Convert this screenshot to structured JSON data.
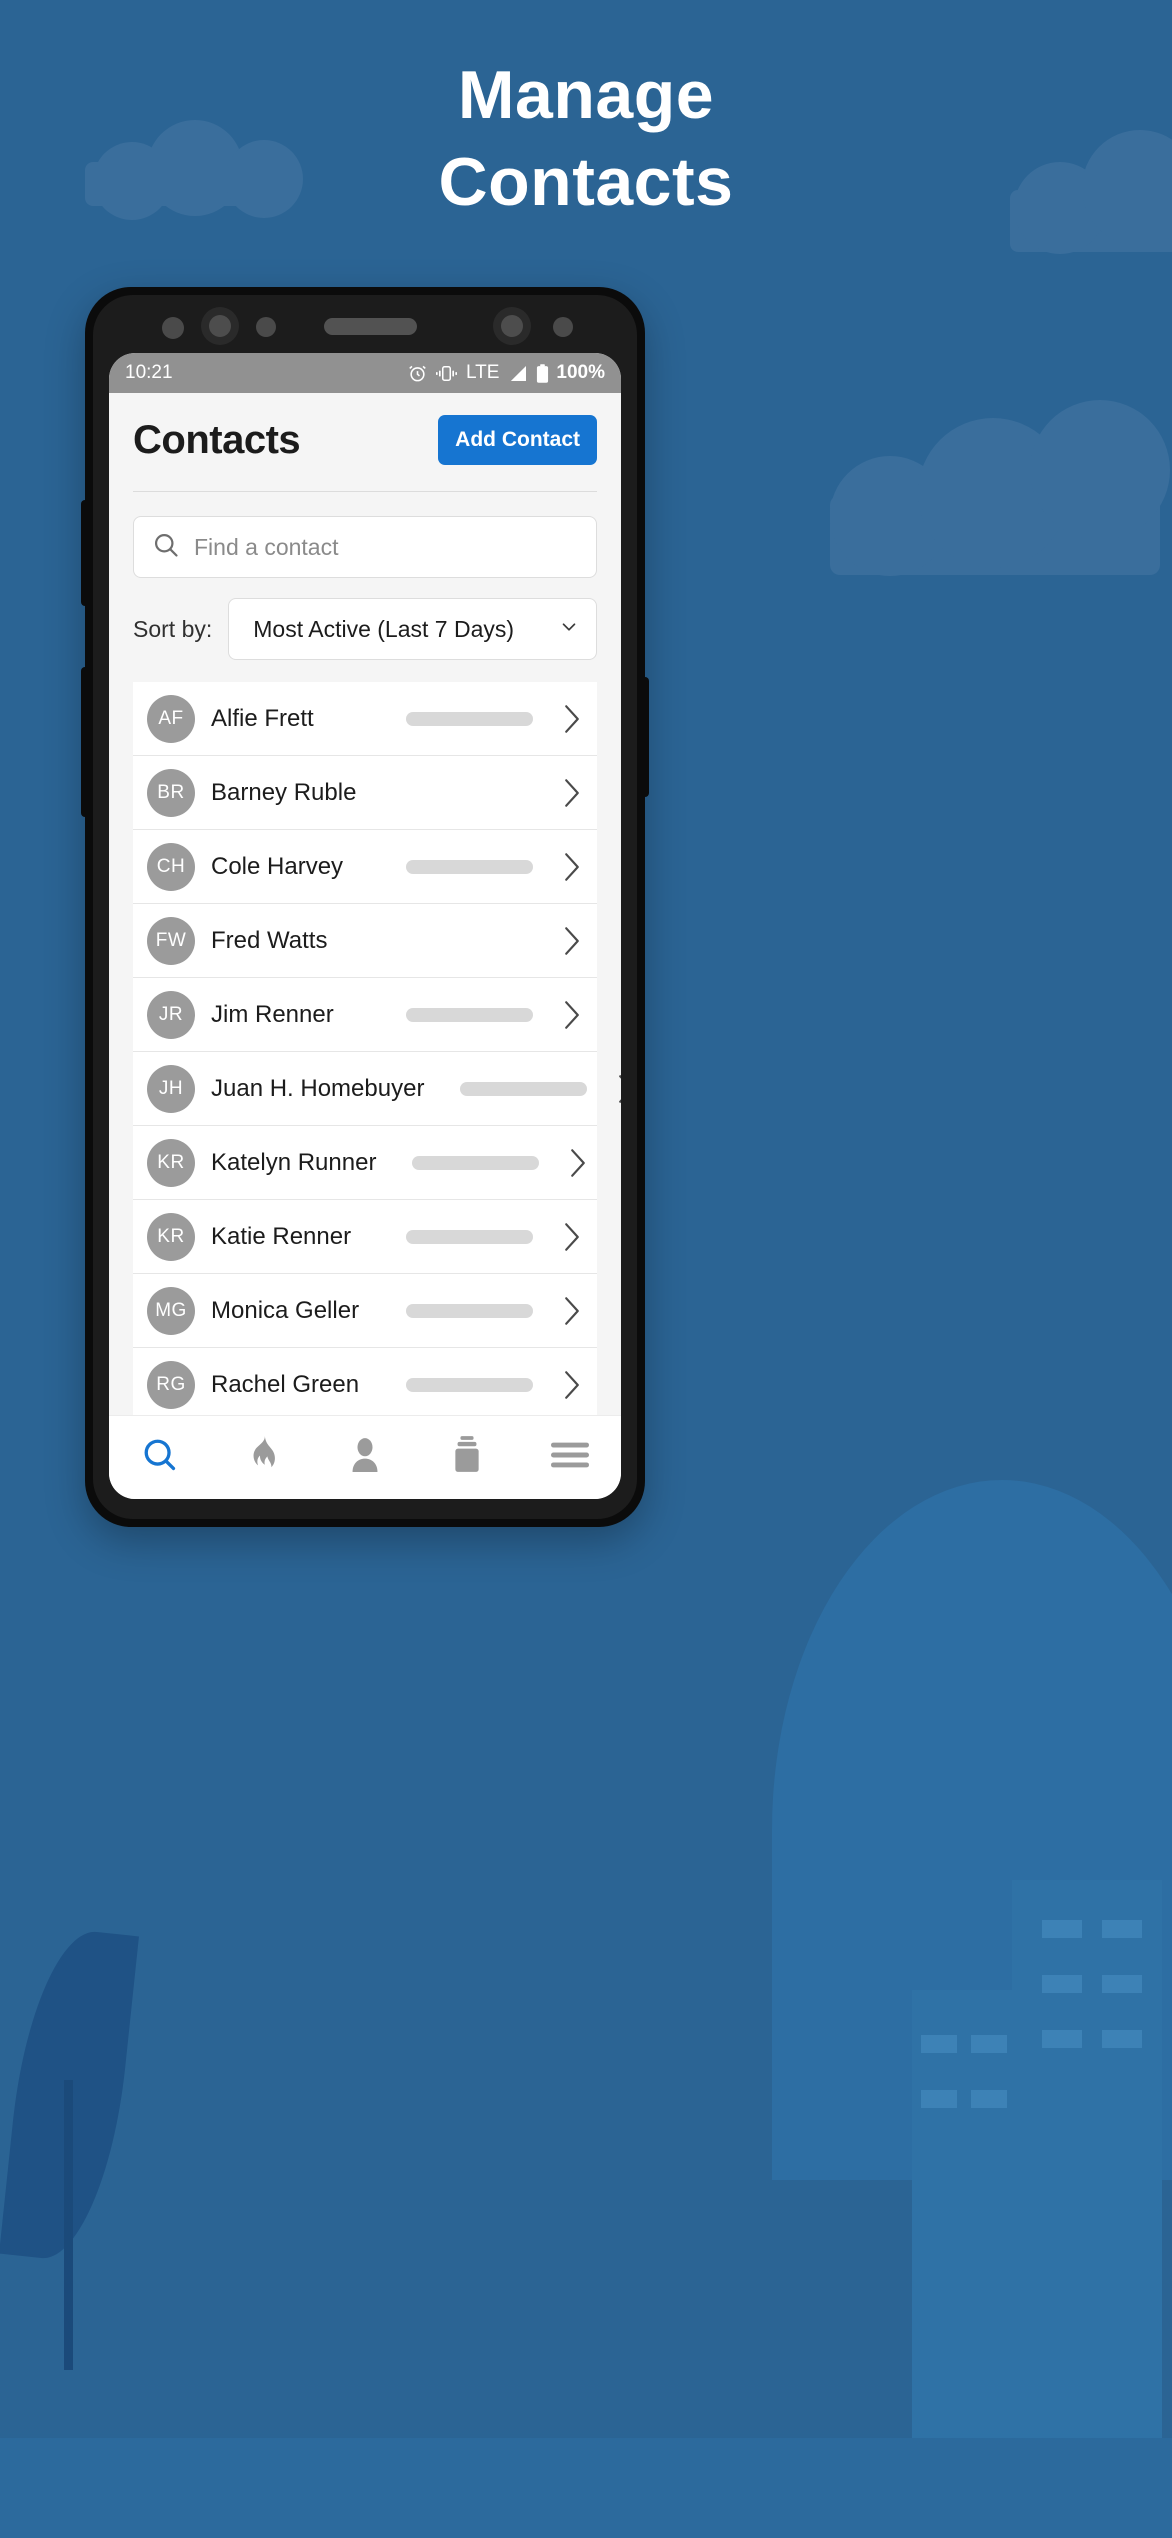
{
  "promo": {
    "headline_line1": "Manage",
    "headline_line2": "Contacts",
    "bg_color": "#2b6494",
    "accent_color": "#1675d1"
  },
  "statusbar": {
    "time": "10:21",
    "battery_percent": "100%",
    "network": "LTE",
    "icons": [
      "alarm-icon",
      "vibrate-icon",
      "signal-icon",
      "battery-icon"
    ]
  },
  "app": {
    "title": "Contacts",
    "add_contact_label": "Add Contact",
    "search": {
      "placeholder": "Find a contact",
      "value": ""
    },
    "sort": {
      "label": "Sort by:",
      "selected": "Most Active (Last 7 Days)"
    },
    "contacts": [
      {
        "initials": "AF",
        "name": "Alfie Frett",
        "has_bar": true
      },
      {
        "initials": "BR",
        "name": "Barney Ruble",
        "has_bar": false
      },
      {
        "initials": "CH",
        "name": "Cole Harvey",
        "has_bar": true
      },
      {
        "initials": "FW",
        "name": "Fred Watts",
        "has_bar": false
      },
      {
        "initials": "JR",
        "name": "Jim Renner",
        "has_bar": true
      },
      {
        "initials": "JH",
        "name": "Juan H. Homebuyer",
        "has_bar": true
      },
      {
        "initials": "KR",
        "name": "Katelyn Runner",
        "has_bar": true
      },
      {
        "initials": "KR",
        "name": "Katie Renner",
        "has_bar": true
      },
      {
        "initials": "MG",
        "name": "Monica Geller",
        "has_bar": true
      },
      {
        "initials": "RG",
        "name": "Rachel Green",
        "has_bar": true
      }
    ],
    "bottom_nav": [
      {
        "icon": "search-icon",
        "active": true
      },
      {
        "icon": "flame-icon",
        "active": false
      },
      {
        "icon": "person-icon",
        "active": false
      },
      {
        "icon": "briefcase-icon",
        "active": false
      },
      {
        "icon": "menu-icon",
        "active": false
      }
    ]
  }
}
